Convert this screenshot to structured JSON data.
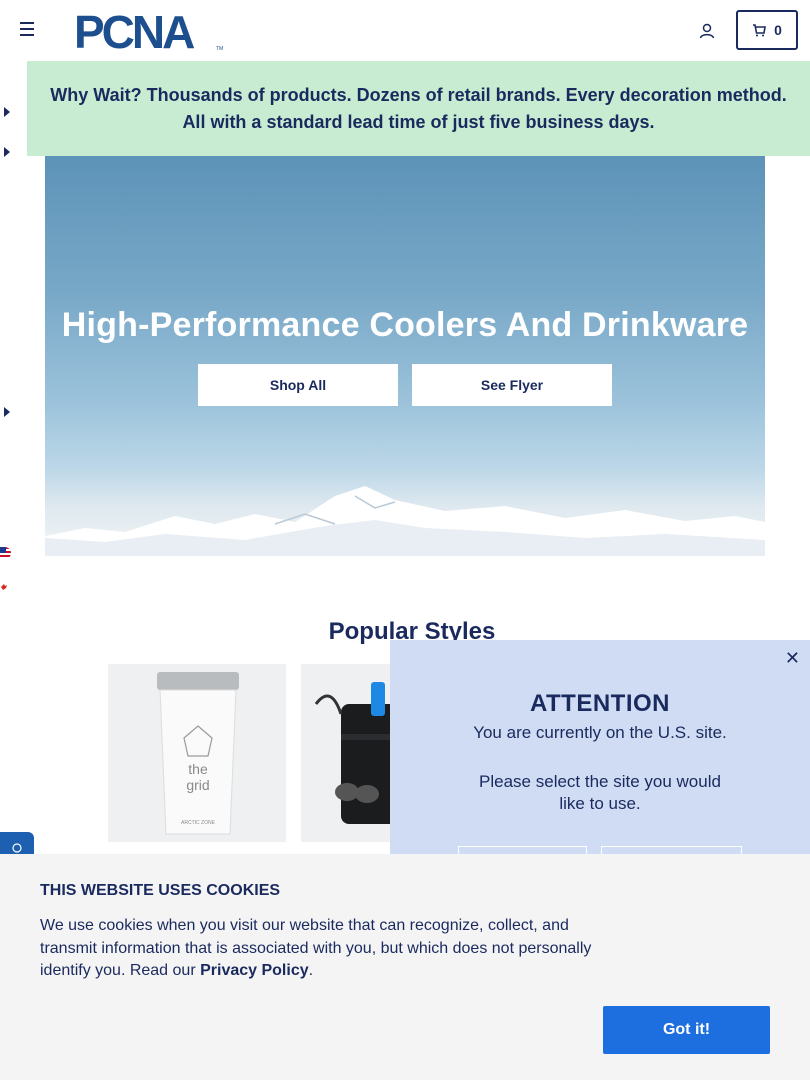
{
  "header": {
    "logo_text": "PCNA",
    "logo_tm": "TM",
    "cart_count": "0"
  },
  "announcement": {
    "text": "Why Wait? Thousands of products. Dozens of retail brands. Every decoration method. All with a standard lead time of just five business days."
  },
  "hero": {
    "title": "High-Performance Coolers And Drinkware",
    "buttons": [
      "Shop All",
      "See Flyer"
    ]
  },
  "popular": {
    "title": "Popular Styles",
    "tumbler_print_1": "the",
    "tumbler_print_2": "grid",
    "tumbler_print_3": "ARCTIC ZONE"
  },
  "modal": {
    "close": "✕",
    "title": "ATTENTION",
    "line1": "You are currently on the U.S. site.",
    "line2": "Please select the site you would like to use."
  },
  "cookie": {
    "title": "THIS WEBSITE USES COOKIES",
    "text_before": "We use cookies when you visit our website that can recognize, collect, and transmit information that is associated with you, but which does not personally identify you. Read our ",
    "link": "Privacy Policy",
    "text_after": ".",
    "button": "Got it!"
  },
  "colors": {
    "navy": "#1a2a5e",
    "announce_bg": "#c8ecd2",
    "modal_bg": "#cfdcf3",
    "cookie_button": "#1d6fe0"
  }
}
